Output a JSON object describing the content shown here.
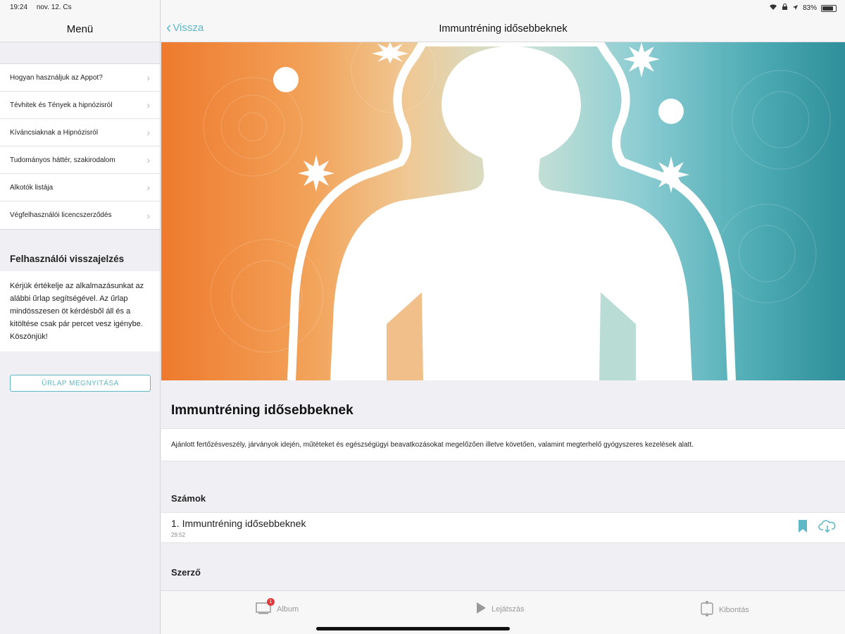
{
  "status": {
    "time": "19:24",
    "date": "nov. 12. Cs",
    "battery": "83%"
  },
  "sidebar": {
    "title": "Menü",
    "items": [
      {
        "label": "Hogyan használjuk az Appot?"
      },
      {
        "label": "Tévhitek és Tények a hipnózisról"
      },
      {
        "label": "Kíváncsiaknak a Hipnózisról"
      },
      {
        "label": "Tudományos háttér, szakirodalom"
      },
      {
        "label": "Alkotók listája"
      },
      {
        "label": "Végfelhasználói licencszerződés"
      }
    ],
    "feedback_title": "Felhasználói visszajelzés",
    "feedback_text": "Kérjük értékelje az alkalmazásunkat az alábbi űrlap segítségével. Az űrlap mindösszesen öt kérdésből áll és a kitöltése csak pár percet vesz igénybe. Köszönjük!",
    "open_form_label": "ŰRLAP MEGNYITÁSA"
  },
  "nav": {
    "back_label": "Vissza",
    "title": "Immuntréning idősebbeknek"
  },
  "album": {
    "title": "Immuntréning idősebbeknek",
    "description": "Ajánlott fertőzésveszély, járványok idején, műtéteket és egészségügyi beavatkozásokat megelőzően illetve követően, valamint megterhelő gyógyszeres kezelések alatt."
  },
  "tracks_section": "Számok",
  "tracks": [
    {
      "title": "1. Immuntréning idősebbeknek",
      "duration": "29:52"
    }
  ],
  "author_section": "Szerző",
  "tabbar": {
    "album": "Album",
    "album_badge": "1",
    "play": "Lejátszás",
    "expand": "Kibontás"
  },
  "colors": {
    "accent": "#5fb8c6",
    "badge": "#e23b3b",
    "hero_left": "#ee7a2d",
    "hero_right": "#2f8f9a"
  }
}
